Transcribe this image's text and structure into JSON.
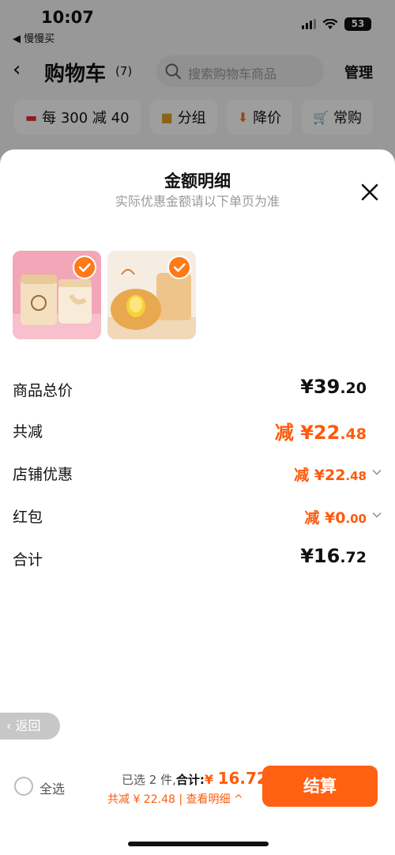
{
  "status": {
    "time": "10:07",
    "back_app": "◀ 慢慢买",
    "battery": "53"
  },
  "nav": {
    "back": "‹",
    "title": "购物车",
    "count": "(7)",
    "search_placeholder": "搜索购物车商品",
    "manage": "管理"
  },
  "chips": [
    {
      "icon": "coupon-icon",
      "label": "每 300 减 40"
    },
    {
      "icon": "folder-icon",
      "label": "分组"
    },
    {
      "icon": "price-down-icon",
      "label": "降价"
    },
    {
      "icon": "cart-icon",
      "label": "常购"
    }
  ],
  "sheet": {
    "title": "金额明细",
    "subtitle": "实际优惠金额请以下单页为准"
  },
  "rows": {
    "subtotal": {
      "label": "商品总价",
      "prefix": "",
      "main": "¥39",
      "decimal": ".20"
    },
    "total_discount": {
      "label": "共减",
      "prefix": "减 ",
      "main": "¥22",
      "decimal": ".48"
    },
    "store_discount": {
      "label": "店铺优惠",
      "prefix": "减 ",
      "main": "¥22",
      "decimal": ".48"
    },
    "red_packet": {
      "label": "红包",
      "prefix": "减 ",
      "main": "¥0",
      "decimal": ".00"
    },
    "total": {
      "label": "合计",
      "prefix": "",
      "main": "¥16",
      "decimal": ".72"
    }
  },
  "float_back": "‹ 返回",
  "bottom": {
    "select_all": "全选",
    "selected_text": "已选 2 件,",
    "total_label": "合计:",
    "yen": "¥ ",
    "total_value": "16.72",
    "discount_text": "共减 ¥ 22.48 | 查看明细 ^",
    "checkout": "结算"
  },
  "colors": {
    "accent": "#ff6012",
    "discount_text": "#ff5a0a",
    "check_badge": "#ff7a1a"
  }
}
